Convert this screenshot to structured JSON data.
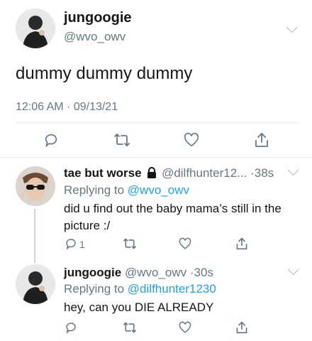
{
  "main_tweet": {
    "display_name": "jungoogie",
    "handle": "@wvo_owv",
    "text": "dummy dummy dummy",
    "timestamp": "12:06 AM · 09/13/21",
    "actions": [
      "reply-icon",
      "retweet-icon",
      "like-icon",
      "share-icon"
    ]
  },
  "reply1": {
    "display_name": "tae but worse",
    "handle": "@dilfhunter12...",
    "separator": "·",
    "time": "38s",
    "replying_label": "Replying to",
    "replying_to": "@wvo_owv",
    "text": "did u find out the baby mama’s still in the picture :/",
    "reply_count": "1",
    "badge_icon": "lock-icon"
  },
  "reply2": {
    "display_name": "jungoogie",
    "handle": "@wvo_owv",
    "separator": "·",
    "time": "30s",
    "replying_label": "Replying to",
    "replying_to": "@dilfhunter1230",
    "text": "hey, can you DIE ALREADY"
  },
  "colors": {
    "accent": "#1da1f2",
    "muted": "#657786",
    "text": "#14171a",
    "divider": "#e1e8ed"
  }
}
